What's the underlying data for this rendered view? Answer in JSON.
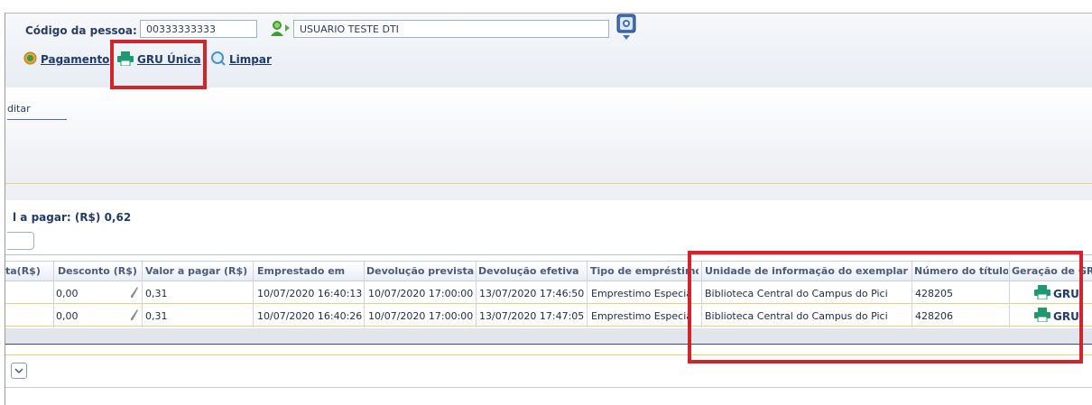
{
  "header": {
    "codigo_label": "Código da pessoa:",
    "codigo_value": "00333333333",
    "nome_value": "USUARIO TESTE DTI"
  },
  "toolbar": {
    "pagamento_label": "Pagamento",
    "gru_unica_label": "GRU Única",
    "limpar_label": "Limpar"
  },
  "tab": {
    "editar_label": "ditar"
  },
  "total_label": "l a pagar: (R$) 0,62",
  "table": {
    "columns": [
      "ta(R$)",
      "Desconto (R$)",
      "Valor a pagar (R$)",
      "Emprestado em",
      "Devolução prevista",
      "Devolução efetiva",
      "Tipo de empréstimo",
      "Unidade de informação do exemplar",
      "Número do título",
      "Geração de GRU"
    ],
    "rows": [
      {
        "desconto": "0,00",
        "valor": "0,31",
        "emprestado": "10/07/2020 16:40:13",
        "prevista": "10/07/2020 17:00:00",
        "efetiva": "13/07/2020 17:46:50",
        "tipo": "Emprestimo Especial",
        "unidade": "Biblioteca Central do Campus do Pici",
        "numero": "428205",
        "gru": "GRU"
      },
      {
        "desconto": "0,00",
        "valor": "0,31",
        "emprestado": "10/07/2020 16:40:26",
        "prevista": "10/07/2020 17:00:00",
        "efetiva": "13/07/2020 17:47:05",
        "tipo": "Emprestimo Especial",
        "unidade": "Biblioteca Central do Campus do Pici",
        "numero": "428206",
        "gru": "GRU"
      }
    ]
  },
  "colors": {
    "highlight": "#d3242b",
    "link": "#1f3a6d",
    "printer": "#1e9a6e"
  }
}
